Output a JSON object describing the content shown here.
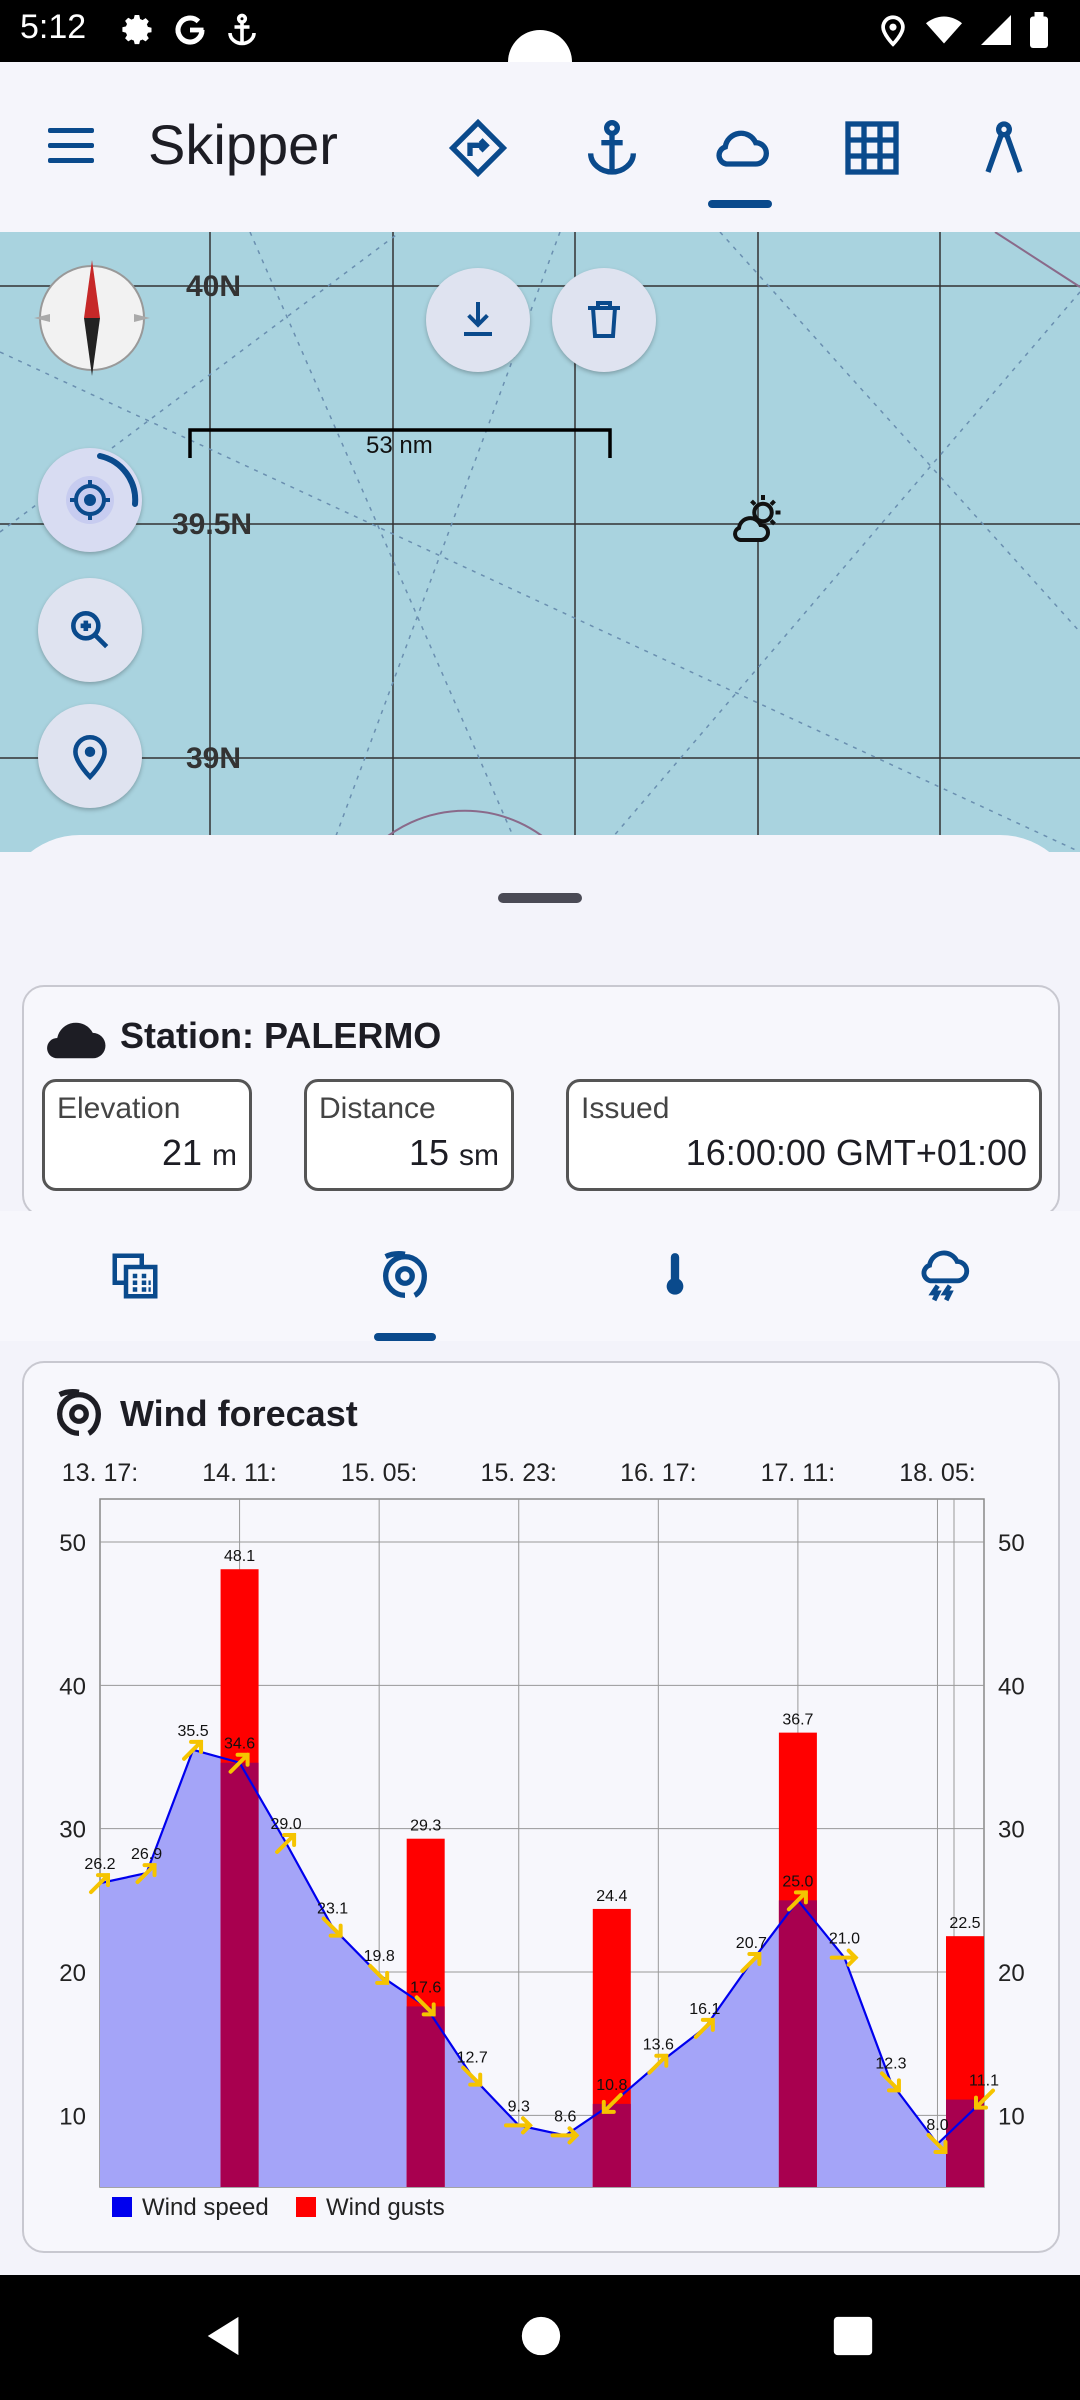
{
  "status_bar": {
    "time": "5:12"
  },
  "app_bar": {
    "title": "Skipper"
  },
  "map": {
    "lat_labels": [
      "40N",
      "39.5N",
      "39N"
    ],
    "scale_label": "53 nm"
  },
  "station": {
    "title": "Station: PALERMO",
    "elevation": {
      "label": "Elevation",
      "value": "21",
      "unit": "m"
    },
    "distance": {
      "label": "Distance",
      "value": "15",
      "unit": "sm"
    },
    "issued": {
      "label": "Issued",
      "value": "16:00:00 GMT+01:00"
    }
  },
  "chart_card": {
    "title": "Wind forecast"
  },
  "chart_data": {
    "type": "bar",
    "time_labels": [
      "13. 17:",
      "14. 11:",
      "15. 05:",
      "15. 23:",
      "16. 17:",
      "17. 11:",
      "18. 05:"
    ],
    "ylim": [
      5,
      53
    ],
    "yticks": [
      10,
      20,
      30,
      40,
      50
    ],
    "grid": true,
    "legend_position": "bottom-left",
    "series": [
      {
        "name": "Wind speed",
        "color": "#0000ee",
        "type": "area-line",
        "points": [
          {
            "i": 0,
            "v": 26.2
          },
          {
            "i": 1,
            "v": 26.9
          },
          {
            "i": 2,
            "v": 35.5
          },
          {
            "i": 3,
            "v": 34.6
          },
          {
            "i": 4,
            "v": 29.0
          },
          {
            "i": 5,
            "v": 23.1
          },
          {
            "i": 6,
            "v": 19.8
          },
          {
            "i": 7,
            "v": 17.6
          },
          {
            "i": 8,
            "v": 12.7
          },
          {
            "i": 9,
            "v": 9.3
          },
          {
            "i": 10,
            "v": 8.6
          },
          {
            "i": 11,
            "v": 10.8
          },
          {
            "i": 12,
            "v": 13.6
          },
          {
            "i": 13,
            "v": 16.1
          },
          {
            "i": 14,
            "v": 20.7
          },
          {
            "i": 15,
            "v": 25.0
          },
          {
            "i": 16,
            "v": 21.0
          },
          {
            "i": 17,
            "v": 12.3
          },
          {
            "i": 18,
            "v": 8.0
          },
          {
            "i": 19,
            "v": 11.1
          }
        ]
      },
      {
        "name": "Wind gusts",
        "color": "#ff0000",
        "type": "bar",
        "points": [
          {
            "i": 3,
            "v": 48.1
          },
          {
            "i": 7,
            "v": 29.3
          },
          {
            "i": 11,
            "v": 24.4
          },
          {
            "i": 15,
            "v": 36.7
          },
          {
            "i": 19,
            "v": 22.5
          }
        ]
      }
    ]
  }
}
